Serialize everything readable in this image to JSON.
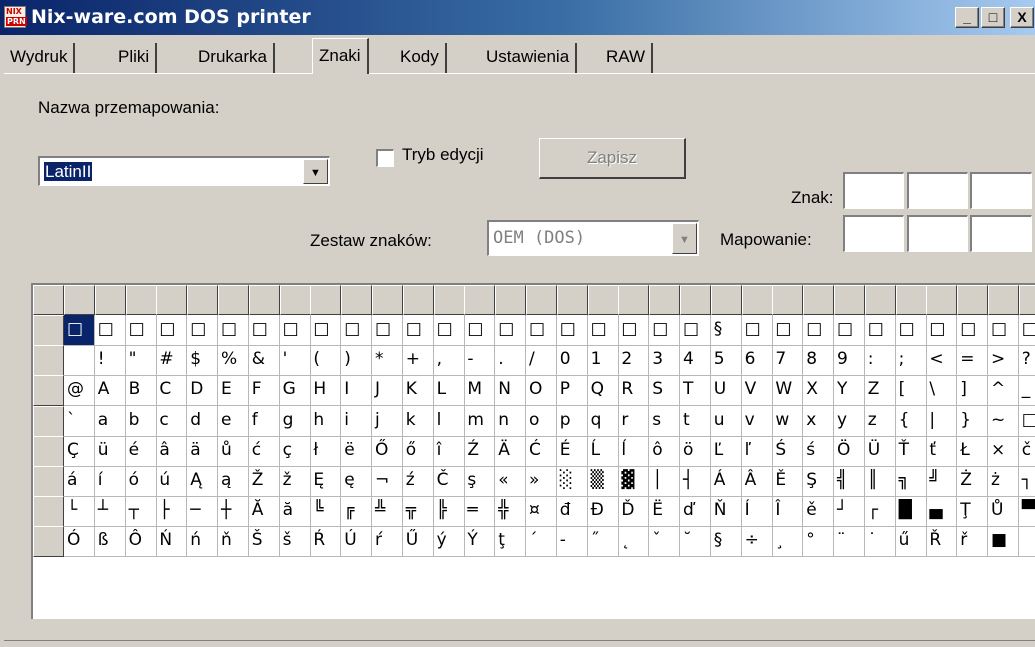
{
  "window": {
    "title": "Nix-ware.com DOS printer",
    "icon_top": "NIX",
    "icon_bottom": "PRN",
    "controls": [
      "_",
      "□",
      "X"
    ]
  },
  "tabs": [
    {
      "label": "Wydruk",
      "active": false
    },
    {
      "label": "Pliki",
      "active": false
    },
    {
      "label": "Drukarka",
      "active": false
    },
    {
      "label": "Znaki",
      "active": true
    },
    {
      "label": "Kody",
      "active": false
    },
    {
      "label": "Ustawienia",
      "active": false
    },
    {
      "label": "RAW",
      "active": false
    }
  ],
  "form": {
    "remap_label": "Nazwa przemapowania:",
    "remap_value": "LatinII",
    "edit_mode_label": "Tryb edycji",
    "edit_mode_checked": false,
    "save_label": "Zapisz",
    "charset_label": "Zestaw znaków:",
    "charset_value": "OEM (DOS)",
    "char_label": "Znak:",
    "mapping_label": "Mapowanie:"
  },
  "char_table": {
    "rows": [
      [
        "□",
        "□",
        "□",
        "□",
        "□",
        "□",
        "□",
        "□",
        "□",
        "□",
        "□",
        "□",
        "□",
        "□",
        "□",
        "□",
        "□",
        "□",
        "□",
        "□",
        "□",
        "§",
        "□",
        "□",
        "□",
        "□",
        "□",
        "□",
        "□",
        "□",
        "□",
        "□"
      ],
      [
        "",
        "!",
        "\"",
        "#",
        "$",
        "%",
        "&",
        "'",
        "(",
        ")",
        "*",
        "+",
        ",",
        "-",
        ".",
        "/",
        "0",
        "1",
        "2",
        "3",
        "4",
        "5",
        "6",
        "7",
        "8",
        "9",
        ":",
        ";",
        "<",
        "=",
        ">",
        "?"
      ],
      [
        "@",
        "A",
        "B",
        "C",
        "D",
        "E",
        "F",
        "G",
        "H",
        "I",
        "J",
        "K",
        "L",
        "M",
        "N",
        "O",
        "P",
        "Q",
        "R",
        "S",
        "T",
        "U",
        "V",
        "W",
        "X",
        "Y",
        "Z",
        "[",
        "\\",
        "]",
        "^",
        "_"
      ],
      [
        "`",
        "a",
        "b",
        "c",
        "d",
        "e",
        "f",
        "g",
        "h",
        "i",
        "j",
        "k",
        "l",
        "m",
        "n",
        "o",
        "p",
        "q",
        "r",
        "s",
        "t",
        "u",
        "v",
        "w",
        "x",
        "y",
        "z",
        "{",
        "|",
        "}",
        "~",
        "□"
      ],
      [
        "Ç",
        "ü",
        "é",
        "â",
        "ä",
        "ů",
        "ć",
        "ç",
        "ł",
        "ë",
        "Ő",
        "ő",
        "î",
        "Ź",
        "Ä",
        "Ć",
        "É",
        "Ĺ",
        "ĺ",
        "ô",
        "ö",
        "Ľ",
        "ľ",
        "Ś",
        "ś",
        "Ö",
        "Ü",
        "Ť",
        "ť",
        "Ł",
        "×",
        "č"
      ],
      [
        "á",
        "í",
        "ó",
        "ú",
        "Ą",
        "ą",
        "Ž",
        "ž",
        "Ę",
        "ę",
        "¬",
        "ź",
        "Č",
        "ş",
        "«",
        "»",
        "░",
        "▒",
        "▓",
        "│",
        "┤",
        "Á",
        "Â",
        "Ě",
        "Ş",
        "╣",
        "║",
        "╗",
        "╝",
        "Ż",
        "ż",
        "┐"
      ],
      [
        "└",
        "┴",
        "┬",
        "├",
        "─",
        "┼",
        "Ă",
        "ă",
        "╚",
        "╔",
        "╩",
        "╦",
        "╠",
        "═",
        "╬",
        "¤",
        "đ",
        "Đ",
        "Ď",
        "Ë",
        "ď",
        "Ň",
        "Í",
        "Î",
        "ě",
        "┘",
        "┌",
        "█",
        "▄",
        "Ţ",
        "Ů",
        "▀"
      ],
      [
        "Ó",
        "ß",
        "Ô",
        "Ń",
        "ń",
        "ň",
        "Š",
        "š",
        "Ŕ",
        "Ú",
        "ŕ",
        "Ű",
        "ý",
        "Ý",
        "ţ",
        "´",
        "-",
        "˝",
        "˛",
        "ˇ",
        "˘",
        "§",
        "÷",
        "¸",
        "°",
        "¨",
        "˙",
        "ű",
        "Ř",
        "ř",
        "■",
        ""
      ]
    ]
  }
}
